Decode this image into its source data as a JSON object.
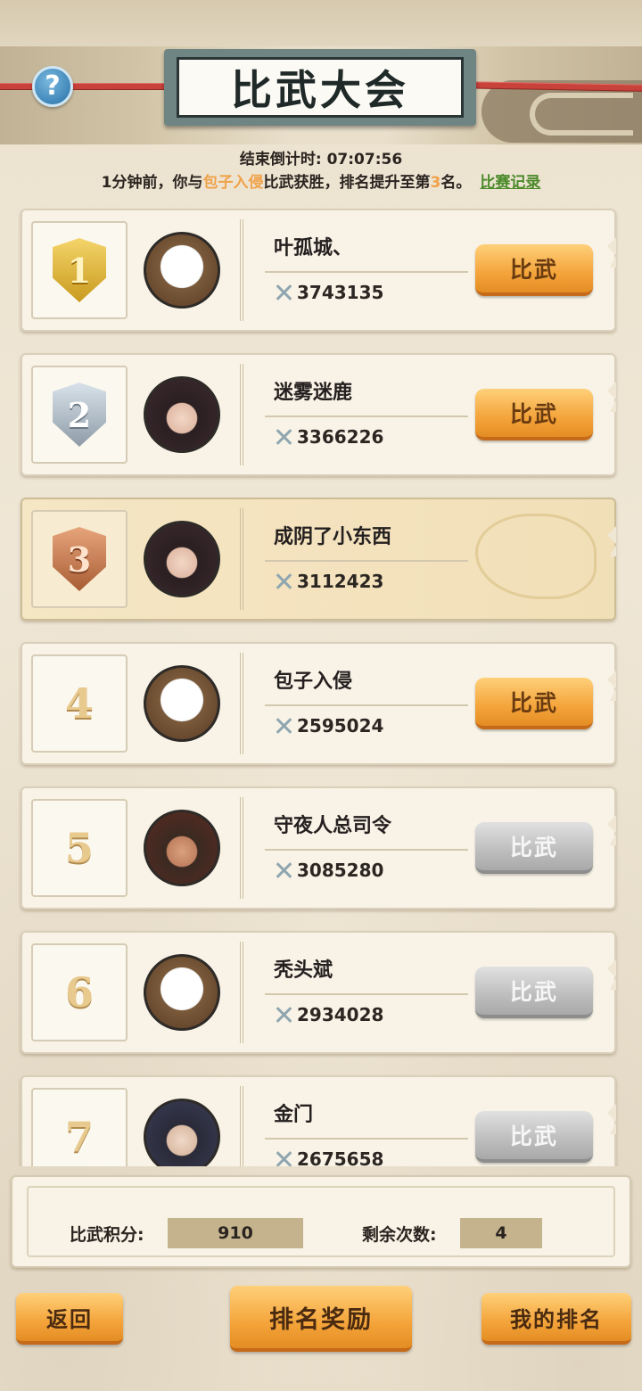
{
  "header": {
    "title": "比武大会",
    "help_symbol": "?",
    "countdown_label": "结束倒计时:",
    "countdown_value": "07:07:56"
  },
  "notice": {
    "prefix": "1分钟前，你与",
    "opponent": "包子入侵",
    "middle": "比武获胜，排名提升至第",
    "rank": "3",
    "suffix": "名。",
    "record_link": "比赛记录"
  },
  "ranking": [
    {
      "rank": "1",
      "badge": "gold",
      "avatar": "panda",
      "name": "叶孤城、",
      "power": "3743135",
      "button": "比武",
      "button_enabled": true,
      "is_self": false
    },
    {
      "rank": "2",
      "badge": "silver",
      "avatar": "woman",
      "name": "迷雾迷鹿",
      "power": "3366226",
      "button": "比武",
      "button_enabled": true,
      "is_self": false
    },
    {
      "rank": "3",
      "badge": "bronze",
      "avatar": "woman",
      "name": "成阴了小东西",
      "power": "3112423",
      "button": "",
      "button_enabled": false,
      "is_self": true
    },
    {
      "rank": "4",
      "badge": "",
      "avatar": "panda",
      "name": "包子入侵",
      "power": "2595024",
      "button": "比武",
      "button_enabled": true,
      "is_self": false
    },
    {
      "rank": "5",
      "badge": "",
      "avatar": "man",
      "name": "守夜人总司令",
      "power": "3085280",
      "button": "比武",
      "button_enabled": false,
      "is_self": false
    },
    {
      "rank": "6",
      "badge": "",
      "avatar": "panda",
      "name": "秃头斌",
      "power": "2934028",
      "button": "比武",
      "button_enabled": false,
      "is_self": false
    },
    {
      "rank": "7",
      "badge": "",
      "avatar": "scholar",
      "name": "金门",
      "power": "2675658",
      "button": "比武",
      "button_enabled": false,
      "is_self": false
    }
  ],
  "stats": {
    "points_label": "比武积分:",
    "points_value": "910",
    "remaining_label": "剩余次数:",
    "remaining_value": "4"
  },
  "buttons": {
    "back": "返回",
    "rewards": "排名奖励",
    "my_rank": "我的排名"
  },
  "colors": {
    "highlight": "#f0a24a",
    "link": "#4b8a2a",
    "button_active": "#f4a43a",
    "button_disabled": "#bdbdbd"
  }
}
